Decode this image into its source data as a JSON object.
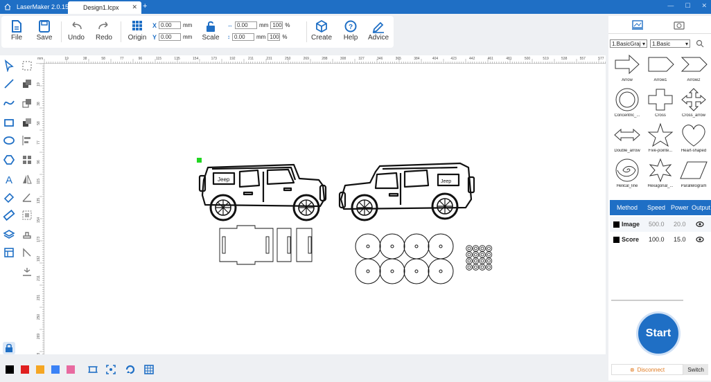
{
  "app": {
    "title": "LaserMaker 2.0.15",
    "document_tab": "Design1.lcpx",
    "accent": "#1f6fc5"
  },
  "toolbar": {
    "file": "File",
    "save": "Save",
    "undo": "Undo",
    "redo": "Redo",
    "origin": "Origin",
    "scale": "Scale",
    "create": "Create",
    "help": "Help",
    "advice": "Advice",
    "x_label": "X",
    "y_label": "Y",
    "x_value": "0.00",
    "y_value": "0.00",
    "w_value": "0.00",
    "h_value": "0.00",
    "unit": "mm",
    "w_percent": "100",
    "h_percent": "100",
    "percent": "%"
  },
  "ruler": {
    "unit": "mm",
    "ticks": [
      "19",
      "38",
      "58",
      "77",
      "96",
      "115",
      "135",
      "154",
      "173",
      "192",
      "211",
      "231",
      "250",
      "269",
      "288",
      "308",
      "327",
      "346",
      "365",
      "384",
      "404",
      "423",
      "442",
      "461",
      "481",
      "500",
      "519",
      "538",
      "557",
      "577"
    ],
    "vticks": [
      "19",
      "38",
      "58",
      "77",
      "96",
      "115",
      "135",
      "154",
      "173",
      "192",
      "211",
      "231",
      "250",
      "269",
      "288"
    ]
  },
  "shape_library": {
    "category": "1.BasicGraj",
    "subcategory": "1.Basic",
    "shapes": [
      {
        "name": "Arrow"
      },
      {
        "name": "Arrow1"
      },
      {
        "name": "Arrow2"
      },
      {
        "name": "Concentric_..."
      },
      {
        "name": "Cross"
      },
      {
        "name": "Cross_arrow"
      },
      {
        "name": "Double_arrow"
      },
      {
        "name": "Five-pointe..."
      },
      {
        "name": "Heart-shaped"
      },
      {
        "name": "Helical_line"
      },
      {
        "name": "Hexagonal_..."
      },
      {
        "name": "Parallelogram"
      }
    ]
  },
  "layers": {
    "headers": {
      "method": "Method",
      "speed": "Speed",
      "power": "Power",
      "output": "Output"
    },
    "rows": [
      {
        "method": "Image",
        "speed": "500.0",
        "power": "20.0",
        "color": "#000000"
      },
      {
        "method": "Score",
        "speed": "100.0",
        "power": "15.0",
        "color": "#000000"
      }
    ]
  },
  "controls": {
    "start": "Start",
    "disconnect": "Disconnect",
    "switch": "Switch"
  },
  "palette": [
    "#000000",
    "#e02020",
    "#f5a623",
    "#3b82f6",
    "#e86aa0"
  ],
  "canvas": {
    "jeep_left_text": "Jeep",
    "jeep_right_text": "Jeep"
  }
}
